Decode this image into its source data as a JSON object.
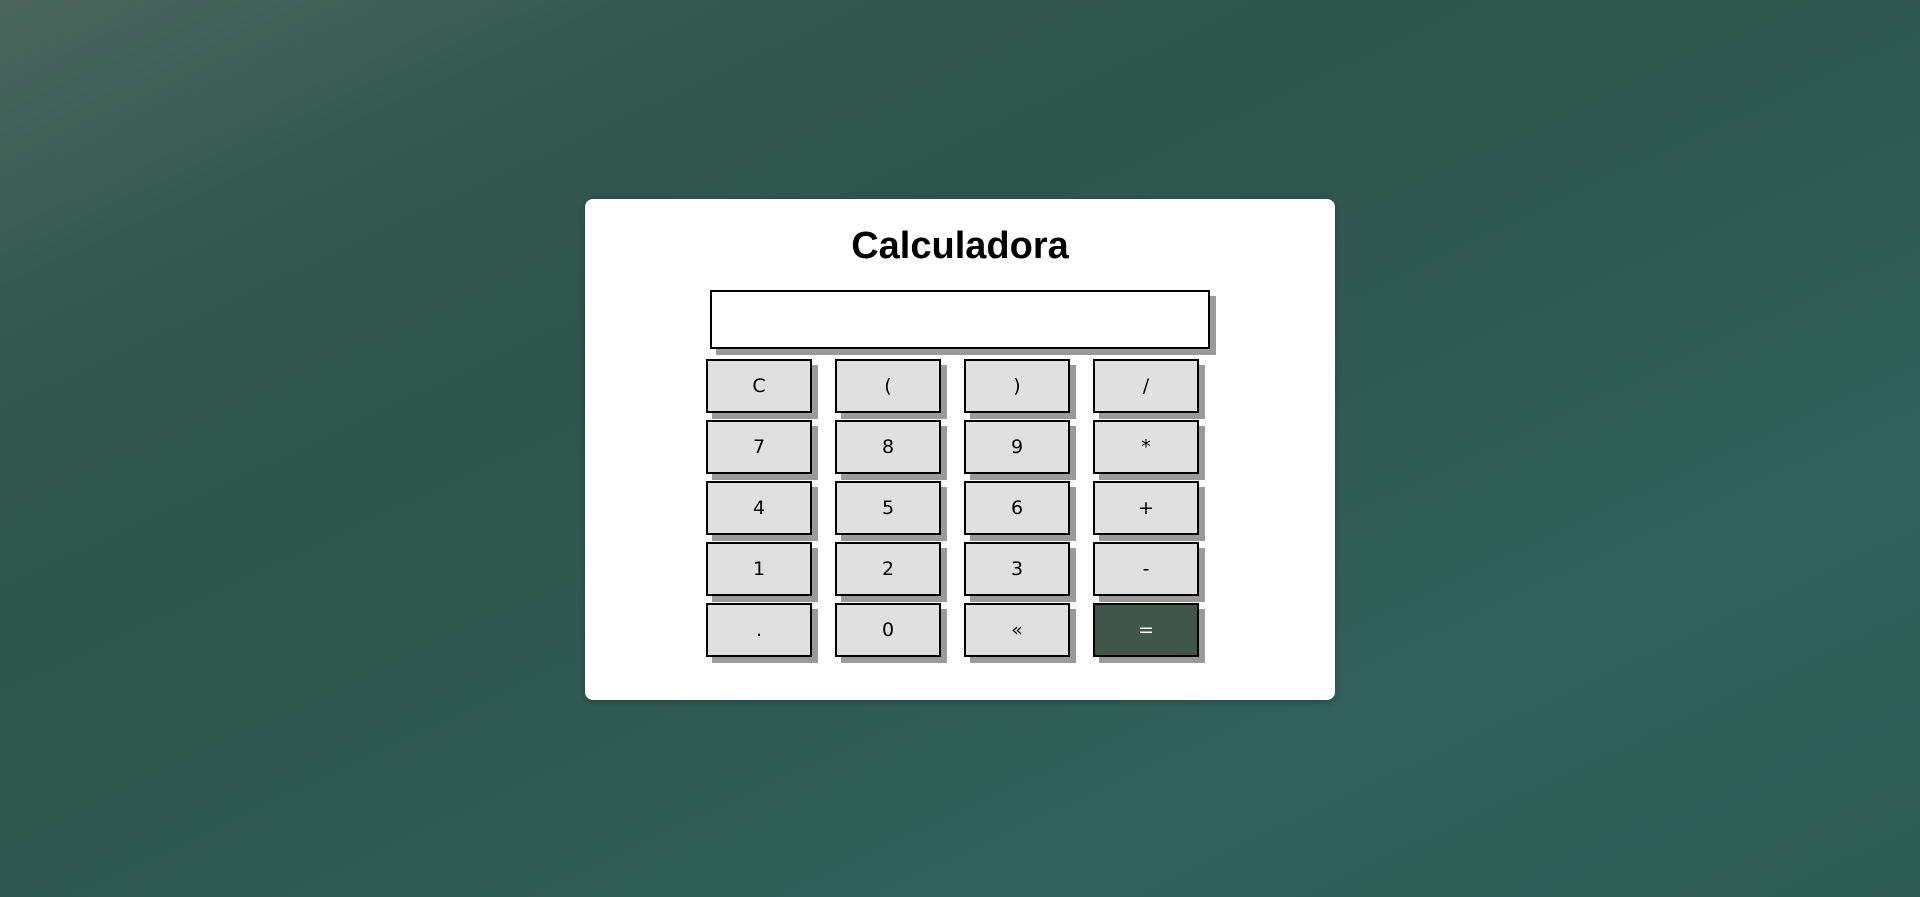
{
  "app": {
    "title": "Calculadora"
  },
  "display": {
    "value": "",
    "placeholder": ""
  },
  "keys": [
    {
      "label": "C",
      "name": "clear-button"
    },
    {
      "label": "(",
      "name": "open-paren-button"
    },
    {
      "label": ")",
      "name": "close-paren-button"
    },
    {
      "label": "/",
      "name": "divide-button"
    },
    {
      "label": "7",
      "name": "digit-7-button"
    },
    {
      "label": "8",
      "name": "digit-8-button"
    },
    {
      "label": "9",
      "name": "digit-9-button"
    },
    {
      "label": "*",
      "name": "multiply-button"
    },
    {
      "label": "4",
      "name": "digit-4-button"
    },
    {
      "label": "5",
      "name": "digit-5-button"
    },
    {
      "label": "6",
      "name": "digit-6-button"
    },
    {
      "label": "+",
      "name": "add-button"
    },
    {
      "label": "1",
      "name": "digit-1-button"
    },
    {
      "label": "2",
      "name": "digit-2-button"
    },
    {
      "label": "3",
      "name": "digit-3-button"
    },
    {
      "label": "-",
      "name": "subtract-button"
    },
    {
      "label": ".",
      "name": "decimal-button"
    },
    {
      "label": "0",
      "name": "digit-0-button"
    },
    {
      "label": "«",
      "name": "backspace-button"
    },
    {
      "label": "=",
      "name": "equals-button"
    }
  ],
  "colors": {
    "background": "#2f5a52",
    "key_background": "#e0e0e0",
    "equals_background": "#3f574a",
    "shadow": "#9a9a9a"
  }
}
